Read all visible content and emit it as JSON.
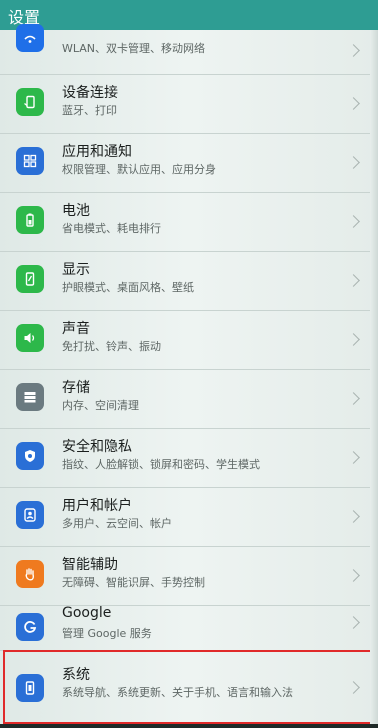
{
  "header": {
    "title": "设置"
  },
  "colors": {
    "accent": "#2e9d93",
    "highlight": "#e02a2a"
  },
  "items": [
    {
      "title": "",
      "subtitle": "WLAN、双卡管理、移动网络",
      "icon": "network-icon",
      "color": "#1f6fe8"
    },
    {
      "title": "设备连接",
      "subtitle": "蓝牙、打印",
      "icon": "device-connect-icon",
      "color": "#2db84a"
    },
    {
      "title": "应用和通知",
      "subtitle": "权限管理、默认应用、应用分身",
      "icon": "apps-icon",
      "color": "#2a6fd6"
    },
    {
      "title": "电池",
      "subtitle": "省电模式、耗电排行",
      "icon": "battery-icon",
      "color": "#2db84a"
    },
    {
      "title": "显示",
      "subtitle": "护眼模式、桌面风格、壁纸",
      "icon": "display-icon",
      "color": "#2db84a"
    },
    {
      "title": "声音",
      "subtitle": "免打扰、铃声、振动",
      "icon": "sound-icon",
      "color": "#2db84a"
    },
    {
      "title": "存储",
      "subtitle": "内存、空间清理",
      "icon": "storage-icon",
      "color": "#6b7a80"
    },
    {
      "title": "安全和隐私",
      "subtitle": "指纹、人脸解锁、锁屏和密码、学生模式",
      "icon": "shield-icon",
      "color": "#2a6fd6"
    },
    {
      "title": "用户和帐户",
      "subtitle": "多用户、云空间、帐户",
      "icon": "user-icon",
      "color": "#2a6fd6"
    },
    {
      "title": "智能辅助",
      "subtitle": "无障碍、智能识屏、手势控制",
      "icon": "hand-icon",
      "color": "#ef7a1f"
    },
    {
      "title": "Google",
      "subtitle": "管理 Google 服务",
      "icon": "google-icon",
      "color": "#2a6fd6"
    },
    {
      "title": "系统",
      "subtitle": "系统导航、系统更新、关于手机、语言和输入法",
      "icon": "system-icon",
      "color": "#2a6fd6"
    }
  ]
}
